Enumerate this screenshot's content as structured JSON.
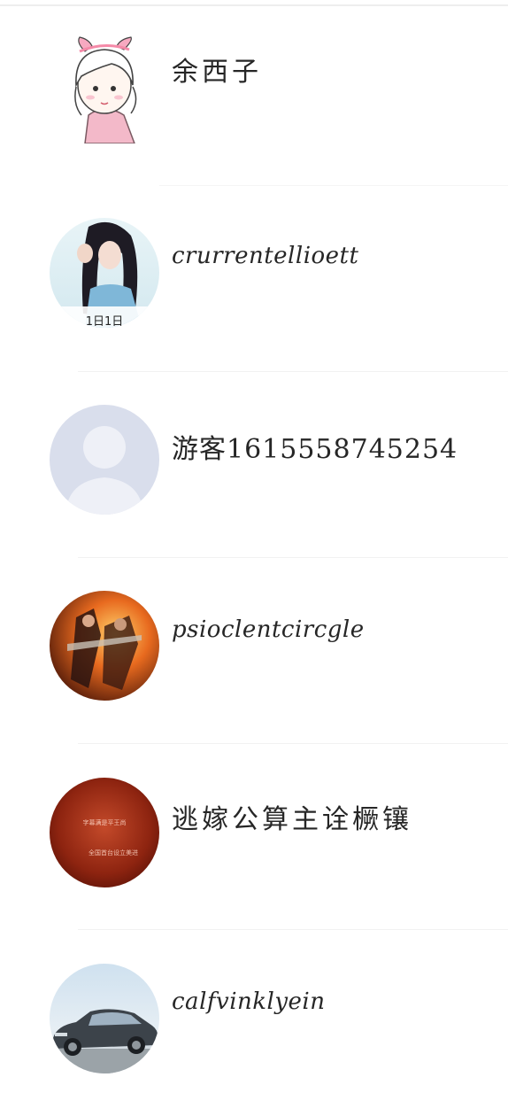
{
  "contacts": [
    {
      "name": "余西子",
      "avatar": "cartoon-girl-avatar"
    },
    {
      "name": "crurrentellioett",
      "avatar": "girl-photo-avatar",
      "avatar_caption": "1日1日"
    },
    {
      "name": "游客1615558745254",
      "avatar": "default-silhouette-avatar"
    },
    {
      "name": "psioclentcircgle",
      "avatar": "game-character-avatar"
    },
    {
      "name": "逃嫁公算主诠橛镶",
      "avatar": "red-text-avatar",
      "avatar_text": [
        "字幕满是平王尚",
        "全国首台设立美进"
      ]
    },
    {
      "name": "calfvinklyein",
      "avatar": "car-photo-avatar"
    }
  ],
  "colors": {
    "background": "#ffffff",
    "name_text": "#262626",
    "divider": "#f1f1f1",
    "silhouette_bg": "#d9deec",
    "silhouette_fg": "#eef0f7"
  }
}
